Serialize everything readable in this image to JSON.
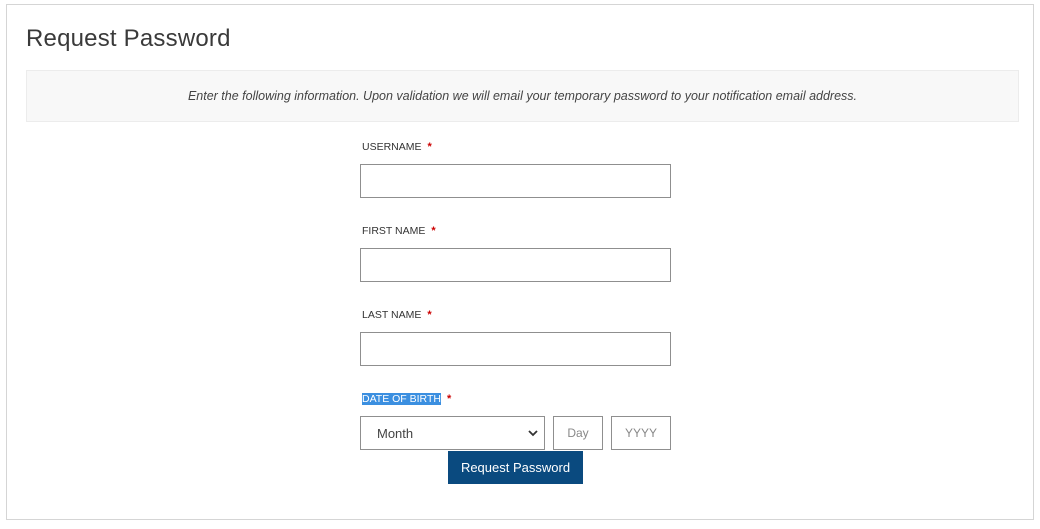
{
  "page": {
    "title": "Request Password",
    "instructions": "Enter the following information. Upon validation we will email your temporary password to your notification email address."
  },
  "form": {
    "required_marker": "*",
    "username": {
      "label": "USERNAME",
      "value": ""
    },
    "first_name": {
      "label": "FIRST NAME",
      "value": ""
    },
    "last_name": {
      "label": "LAST NAME",
      "value": ""
    },
    "date_of_birth": {
      "label": "DATE OF BIRTH",
      "label_selected": true,
      "month": {
        "selected": "Month"
      },
      "day": {
        "placeholder": "Day",
        "value": ""
      },
      "year": {
        "placeholder": "YYYY",
        "value": ""
      }
    },
    "submit_label": "Request Password"
  },
  "colors": {
    "button_bg": "#0a4a7f",
    "required": "#cc0000",
    "selection_highlight": "#3b8fe0"
  },
  "icons": {
    "month_dropdown": "chevron-down-icon"
  }
}
